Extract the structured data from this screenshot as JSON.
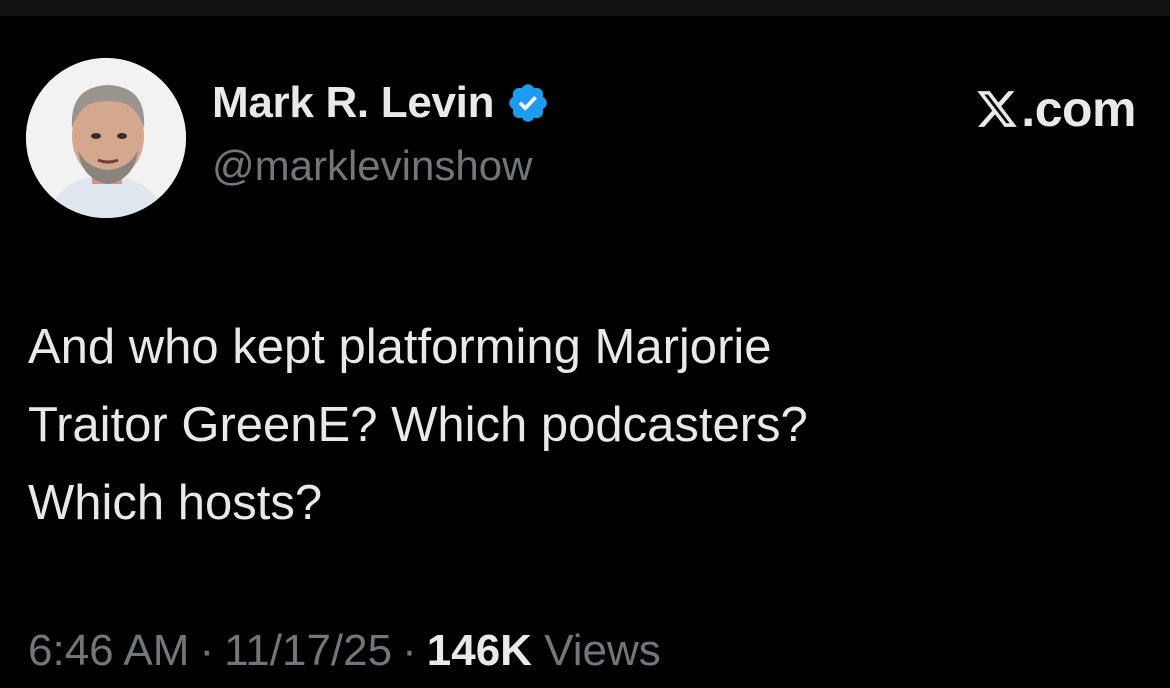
{
  "author": {
    "display_name": "Mark R. Levin",
    "handle": "@marklevinshow",
    "verified": true,
    "avatar_icon": "avatar-photo"
  },
  "brand": {
    "logo_icon": "x-logo-icon",
    "label": ".com"
  },
  "tweet": {
    "text": "And who kept platforming Marjorie\nTraitor GreenE?  Which podcasters?\nWhich hosts?"
  },
  "meta": {
    "time": "6:46 AM",
    "separator": "·",
    "date": "11/17/25",
    "views_count": "146K",
    "views_label": "Views"
  },
  "colors": {
    "background": "#000000",
    "primary_text": "#e7e9ea",
    "secondary_text": "#71767b",
    "verified_badge": "#1d9bf0"
  }
}
